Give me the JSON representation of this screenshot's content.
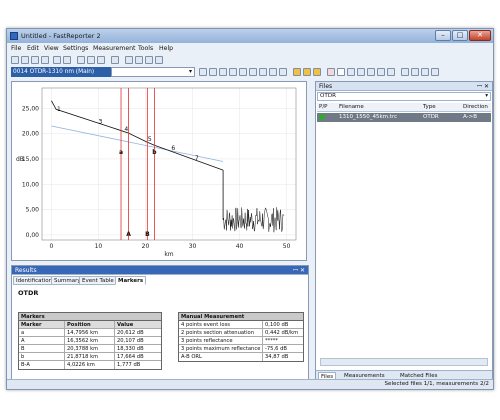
{
  "window": {
    "title": "Untitled - FastReporter 2",
    "minimize": "–",
    "maximize": "□",
    "close": "✕"
  },
  "menu": [
    "File",
    "Edit",
    "View",
    "Settings",
    "Measurement",
    "Tools",
    "Help"
  ],
  "trace_selector": {
    "selected": "0014 OTDR-1310 nm (Main)"
  },
  "chart_data": {
    "type": "line",
    "xlabel": "km",
    "ylabel": "dB",
    "xlim": [
      -2,
      52
    ],
    "ylim": [
      -1,
      29
    ],
    "x_ticks": [
      "0",
      "10",
      "20",
      "30",
      "40",
      "50"
    ],
    "y_ticks": [
      "0,00",
      "5,00",
      "10,00",
      "15,00",
      "20,00",
      "25,00"
    ],
    "series": [
      {
        "values": [
          [
            0,
            26.5
          ],
          [
            1,
            24.8
          ],
          [
            14.8,
            20.6
          ],
          [
            16.4,
            20.1
          ],
          [
            20.4,
            18.3
          ],
          [
            21.9,
            17.7
          ],
          [
            36.5,
            12.8
          ]
        ]
      },
      {
        "values": [
          [
            0,
            21.5
          ],
          [
            36.5,
            14.5
          ]
        ]
      }
    ],
    "noise_floor": {
      "from_km": 36.5,
      "to_km": 49.5,
      "level_db": 3.0
    },
    "event_labels": [
      {
        "text": "1",
        "x": 1.2,
        "y": 24.5
      },
      {
        "text": "3",
        "x": 10,
        "y": 22
      },
      {
        "text": "4",
        "x": 15.5,
        "y": 20.5
      },
      {
        "text": "5",
        "x": 20.5,
        "y": 18.5
      },
      {
        "text": "6",
        "x": 25.5,
        "y": 16.8
      },
      {
        "text": "7",
        "x": 30.5,
        "y": 14.8
      }
    ],
    "markers": [
      {
        "label": "a",
        "km": 14.8
      },
      {
        "label": "A",
        "km": 16.4
      },
      {
        "label": "B",
        "km": 20.4
      },
      {
        "label": "b",
        "km": 21.9
      }
    ]
  },
  "files_panel": {
    "title": "Files",
    "pin": "ꟷ ✕",
    "filter": "OTDR",
    "columns": [
      "P/P",
      "Filename",
      "Type",
      "Direction"
    ],
    "rows": [
      {
        "filename": "1310_1550_45km.trc",
        "type": "OTDR",
        "direction": "A->B"
      }
    ],
    "tabs": [
      "Files",
      "Measurements",
      "Matched Files"
    ]
  },
  "results": {
    "title": "Results",
    "pin": "ꟷ ✕",
    "tabs": [
      "Identification",
      "Summary",
      "Event Table",
      "Markers"
    ],
    "heading": "OTDR",
    "markers_table": {
      "section": "Markers",
      "columns": [
        "Marker",
        "Position",
        "Value"
      ],
      "rows": [
        [
          "a",
          "14,7956 km",
          "20,612 dB"
        ],
        [
          "A",
          "16,3562 km",
          "20,107 dB"
        ],
        [
          "B",
          "20,3788 km",
          "18,330 dB"
        ],
        [
          "b",
          "21,8718 km",
          "17,664 dB"
        ],
        [
          "B-A",
          "4,0226 km",
          "1,777 dB"
        ]
      ]
    },
    "manual_table": {
      "section": "Manual Measurement",
      "rows": [
        [
          "4 points event loss",
          "0,100 dB"
        ],
        [
          "2 points section attenuation",
          "0,442 dB/km"
        ],
        [
          "3 points reflectance",
          "*****"
        ],
        [
          "3 points maximum reflectance",
          "-75,6 dB"
        ],
        [
          "A-B ORL",
          "34,87 dB"
        ]
      ]
    }
  },
  "status": {
    "text": "Selected files 1/1, measurements 2/2"
  },
  "colors": {
    "trace": "#111111",
    "marker": "#e03030",
    "selection": "#2c5fa8",
    "reference": "#8fb3df"
  }
}
